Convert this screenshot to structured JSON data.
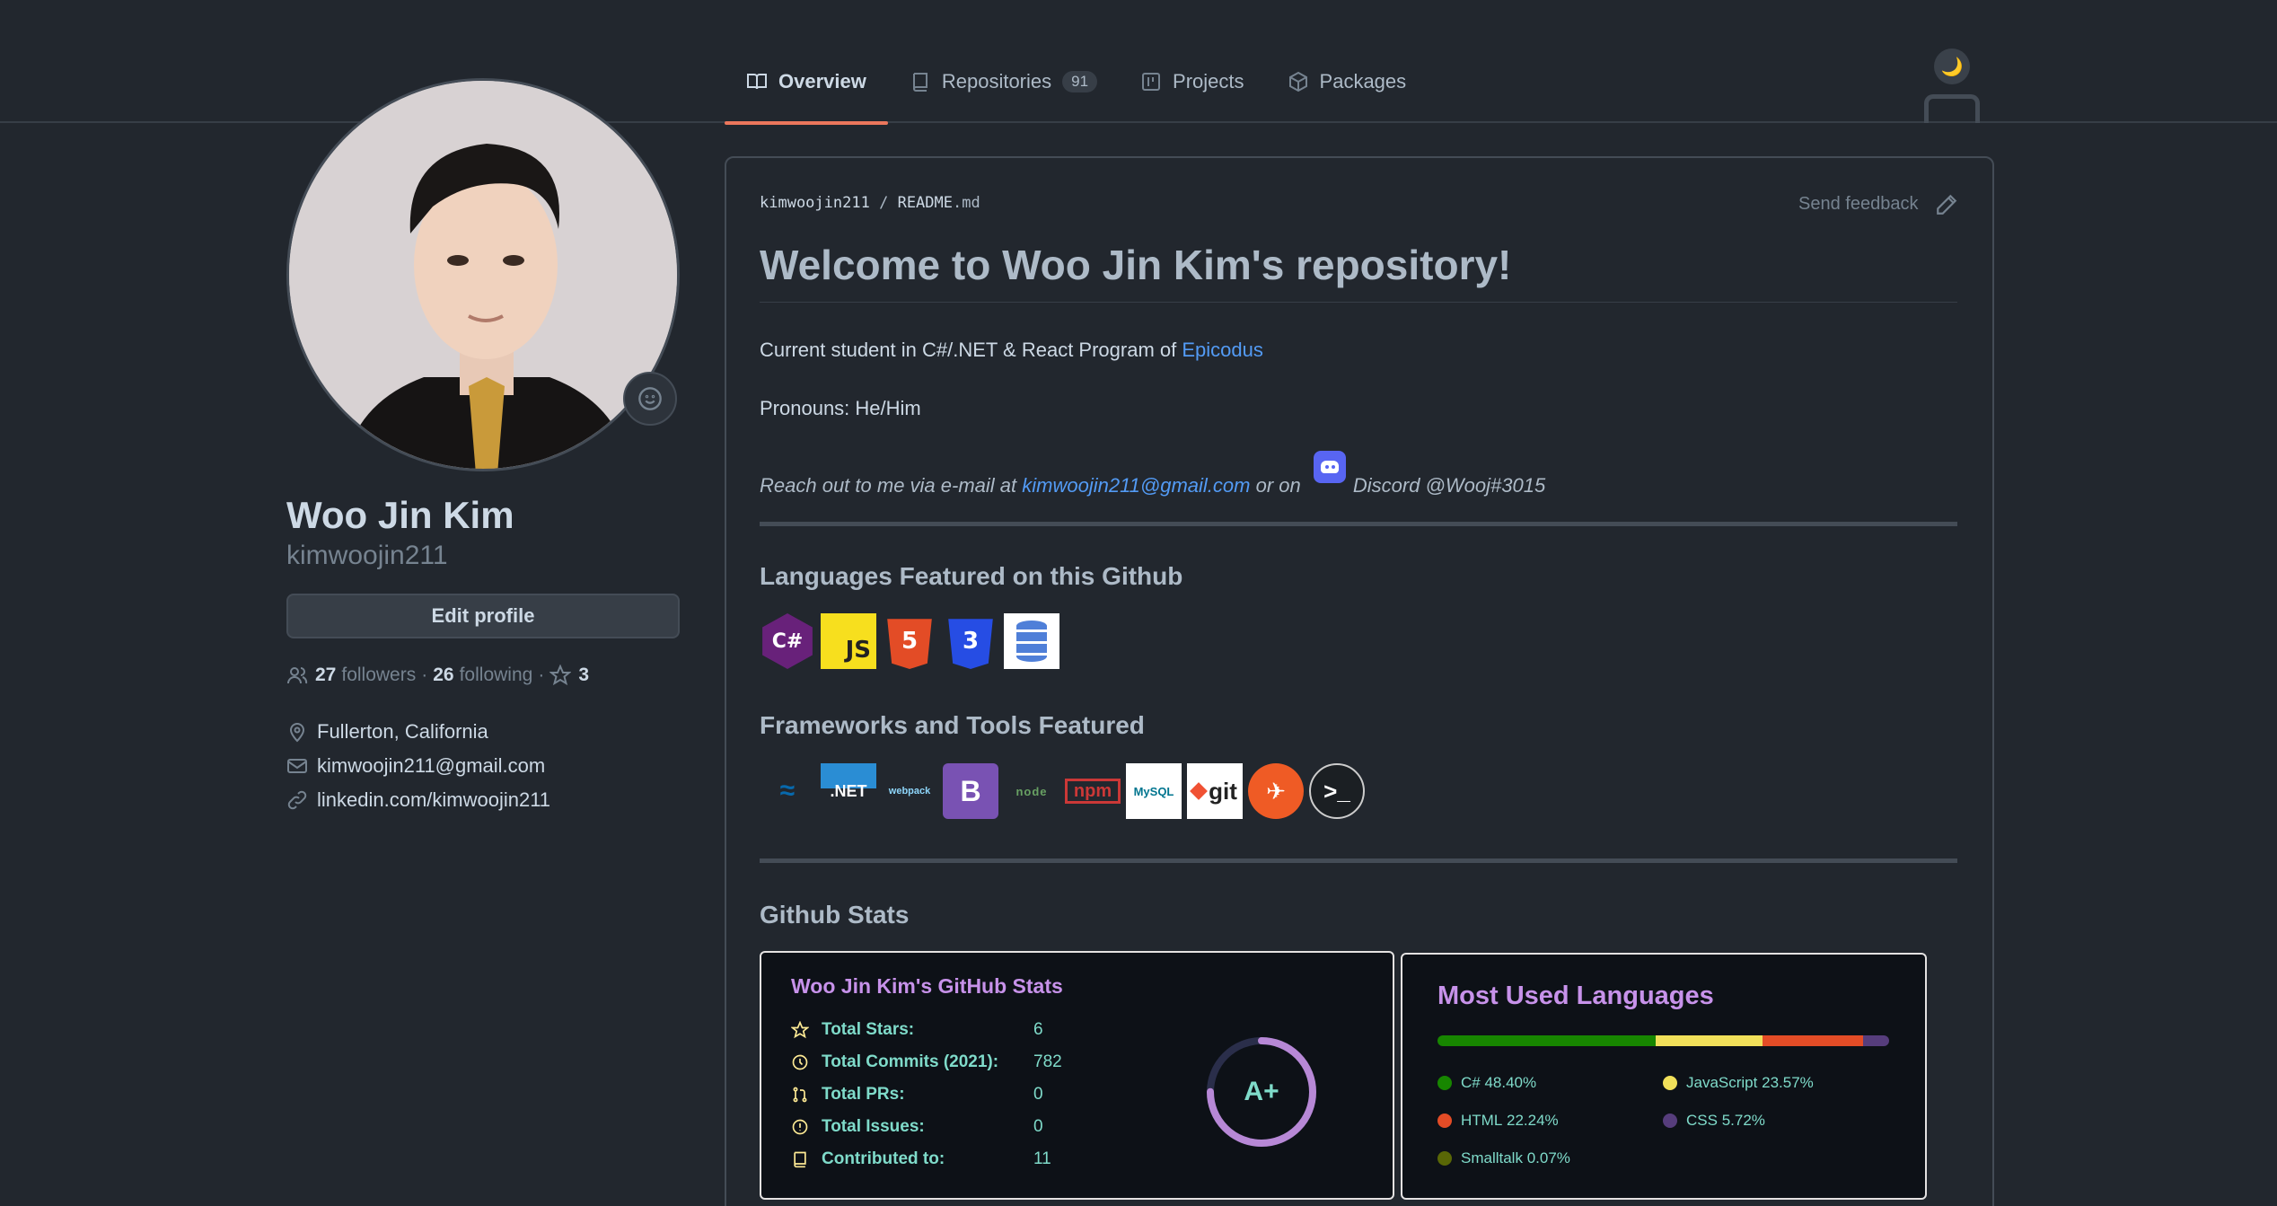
{
  "tabs": [
    {
      "label": "Overview",
      "icon": "book-icon"
    },
    {
      "label": "Repositories",
      "count": "91",
      "icon": "repo-icon"
    },
    {
      "label": "Projects",
      "icon": "project-icon"
    },
    {
      "label": "Packages",
      "icon": "package-icon"
    }
  ],
  "header": {
    "theme_icon": "🌙"
  },
  "profile": {
    "full_name": "Woo Jin Kim",
    "username": "kimwoojin211",
    "edit_label": "Edit profile",
    "followers_count": "27",
    "followers_label": "followers",
    "following_count": "26",
    "following_label": "following",
    "stars_count": "3",
    "separator": "·",
    "location": "Fullerton, California",
    "email": "kimwoojin211@gmail.com",
    "website": "linkedin.com/kimwoojin211"
  },
  "readme": {
    "owner": "kimwoojin211",
    "slash": "/",
    "file": "README",
    "ext": ".md",
    "feedback": "Send feedback",
    "title": "Welcome to Woo Jin Kim's repository!",
    "student_text": "Current student in C#/.NET & React Program of ",
    "student_link": "Epicodus",
    "pronouns": "Pronouns: He/Him",
    "reach_prefix": "Reach out to me via e-mail at ",
    "reach_email": "kimwoojin211@gmail.com",
    "reach_mid": " or on ",
    "reach_discord": "Discord @Wooj#3015",
    "languages_heading": "Languages Featured on this Github",
    "languages": [
      {
        "name": "csharp-icon",
        "label": "C#"
      },
      {
        "name": "javascript-icon",
        "label": "JS"
      },
      {
        "name": "html5-icon",
        "label": "5"
      },
      {
        "name": "css3-icon",
        "label": "3"
      },
      {
        "name": "database-icon",
        "label": ""
      }
    ],
    "tools_heading": "Frameworks and Tools Featured",
    "tools": [
      {
        "name": "jquery-icon",
        "label": "jQuery"
      },
      {
        "name": "dotnet-icon",
        "label": ".NET"
      },
      {
        "name": "webpack-icon",
        "label": "webpack"
      },
      {
        "name": "bootstrap-icon",
        "label": "B"
      },
      {
        "name": "nodejs-icon",
        "label": "node"
      },
      {
        "name": "npm-icon",
        "label": "npm"
      },
      {
        "name": "mysql-icon",
        "label": "MySQL"
      },
      {
        "name": "git-icon",
        "label": "git"
      },
      {
        "name": "postman-icon",
        "label": ""
      },
      {
        "name": "terminal-icon",
        "label": ">_"
      }
    ],
    "stats_heading": "Github Stats"
  },
  "stats_card": {
    "title": "Woo Jin Kim's GitHub Stats",
    "rows": [
      {
        "label": "Total Stars:",
        "value": "6",
        "icon": "star-icon"
      },
      {
        "label": "Total Commits (2021):",
        "value": "782",
        "icon": "history-icon"
      },
      {
        "label": "Total PRs:",
        "value": "0",
        "icon": "pull-request-icon"
      },
      {
        "label": "Total Issues:",
        "value": "0",
        "icon": "issue-icon"
      },
      {
        "label": "Contributed to:",
        "value": "11",
        "icon": "repo-icon"
      }
    ],
    "grade": "A+",
    "grade_progress": 0.75
  },
  "languages_card": {
    "title": "Most Used Languages",
    "languages": [
      {
        "name": "C#",
        "percent": "48.40%",
        "value": 48.4,
        "color": "#178600"
      },
      {
        "name": "JavaScript",
        "percent": "23.57%",
        "value": 23.57,
        "color": "#f1e05a"
      },
      {
        "name": "HTML",
        "percent": "22.24%",
        "value": 22.24,
        "color": "#e34c26"
      },
      {
        "name": "CSS",
        "percent": "5.72%",
        "value": 5.72,
        "color": "#563d7c"
      },
      {
        "name": "Smalltalk",
        "percent": "0.07%",
        "value": 0.07,
        "color": "#596706"
      }
    ]
  },
  "colors": {
    "accent": "#ec775c",
    "link": "#539bf5",
    "card_title": "#c792ea",
    "card_text": "#7fdbca"
  }
}
